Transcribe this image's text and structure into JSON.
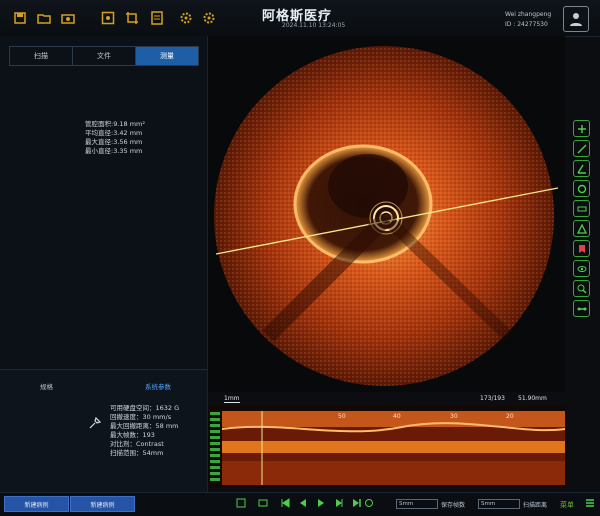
{
  "header": {
    "title": "阿格斯医疗",
    "subtitle": "2024.11.10 13:24:05",
    "user_name": "Wei zhangpeng",
    "user_id": "ID : 24277530"
  },
  "toolbar_icons": [
    "save-icon",
    "folder-icon",
    "camera-icon",
    "grid-icon",
    "settings-icon",
    "gear-icon",
    "document-icon"
  ],
  "left_panel": {
    "tabs": [
      {
        "label": "扫描",
        "active": false
      },
      {
        "label": "文件",
        "active": false
      },
      {
        "label": "测量",
        "active": true
      }
    ],
    "measurements": [
      "管腔面积:9.18 mm²",
      "平均直径:3.42 mm",
      "最大直径:3.56 mm",
      "最小直径:3.35 mm"
    ],
    "lower_tabs": [
      {
        "label": "规格",
        "active": false
      },
      {
        "label": "系统参数",
        "active": true
      }
    ],
    "system_info": [
      "可用硬盘空间：1632 G",
      "回撤速度：30 mm/s",
      "最大回撤距离：58 mm",
      "最大帧数：193",
      "对比剂：Contrast",
      "扫描范围：54mm"
    ]
  },
  "longitudinal": {
    "scale_label": "1mm",
    "frame_counter": "173/193",
    "length_label": "51.90mm",
    "markers": [
      "50",
      "40",
      "30",
      "20"
    ]
  },
  "right_tools": [
    "measure-icon",
    "distance-icon",
    "angle-icon",
    "area-icon",
    "ruler-icon",
    "triangle-icon",
    "bookmark-icon",
    "eye-icon",
    "zoom-icon",
    "link-icon"
  ],
  "bottom": {
    "left_buttons": [
      "新建病例",
      "新建病例"
    ],
    "field1_label": "保存帧数",
    "field1_value": "Smm",
    "field2_label": "扫描距离",
    "field2_value": "Smm",
    "right_label": "菜单"
  },
  "colors": {
    "accent": "#1e5ea6",
    "tool_green": "#3aa53a",
    "image": "#e0621a"
  }
}
